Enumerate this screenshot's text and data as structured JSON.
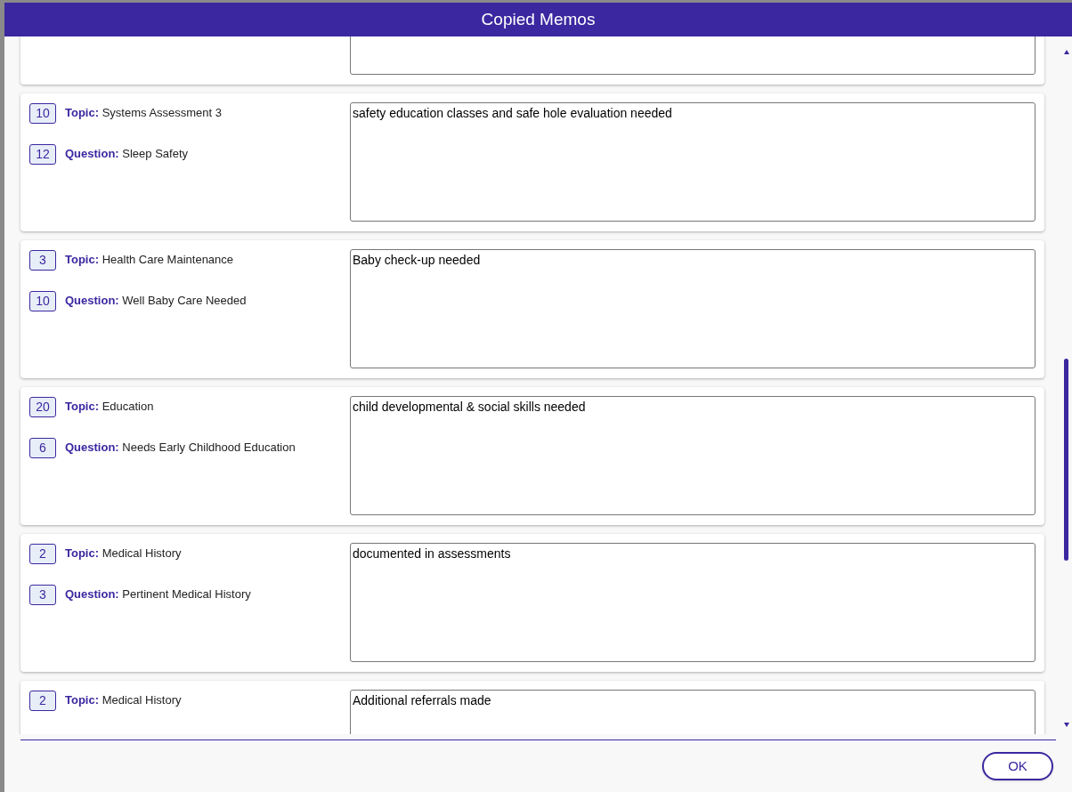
{
  "dialog": {
    "title": "Copied Memos"
  },
  "memos": [
    {
      "topic_number": "10",
      "topic_label": "Topic:",
      "topic": "Systems Assessment 3",
      "question_number": "12",
      "question_label": "Question:",
      "question": "Sleep Safety",
      "memo": "safety education classes and safe hole evaluation needed"
    },
    {
      "topic_number": "3",
      "topic_label": "Topic:",
      "topic": "Health Care Maintenance",
      "question_number": "10",
      "question_label": "Question:",
      "question": "Well Baby Care Needed",
      "memo": "Baby check-up needed"
    },
    {
      "topic_number": "20",
      "topic_label": "Topic:",
      "topic": "Education",
      "question_number": "6",
      "question_label": "Question:",
      "question": "Needs Early Childhood Education",
      "memo": "child developmental & social skills needed"
    },
    {
      "topic_number": "2",
      "topic_label": "Topic:",
      "topic": "Medical History",
      "question_number": "3",
      "question_label": "Question:",
      "question": "Pertinent Medical History",
      "memo": "documented in assessments"
    },
    {
      "topic_number": "2",
      "topic_label": "Topic:",
      "topic": "Medical History",
      "memo": "Additional referrals made"
    }
  ],
  "buttons": {
    "ok": "OK"
  }
}
